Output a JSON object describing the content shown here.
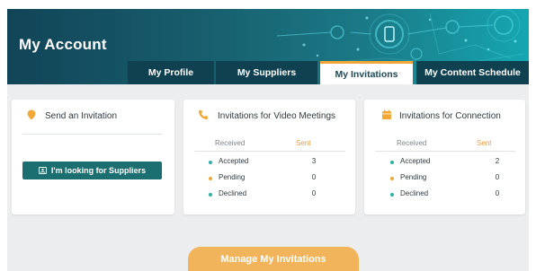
{
  "banner": {
    "title": "My Account"
  },
  "tabs": [
    {
      "label": "My Profile",
      "active": false
    },
    {
      "label": "My Suppliers",
      "active": false
    },
    {
      "label": "My Invitations",
      "active": true
    },
    {
      "label": "My Content Schedule",
      "active": false
    }
  ],
  "send_card": {
    "title": "Send an Invitation",
    "button_label": "I'm looking for Suppliers"
  },
  "video_card": {
    "title": "Invitations for Video Meetings",
    "col_received": "Received",
    "col_sent": "Sent",
    "rows": [
      {
        "label": "Accepted",
        "value": "3",
        "dot": "#2bb3a7"
      },
      {
        "label": "Pending",
        "value": "0",
        "dot": "#f2a736"
      },
      {
        "label": "Declined",
        "value": "0",
        "dot": "#2bb3a7"
      }
    ]
  },
  "connection_card": {
    "title": "Invitations for Connection",
    "col_received": "Received",
    "col_sent": "Sent",
    "rows": [
      {
        "label": "Accepted",
        "value": "2",
        "dot": "#2bb3a7"
      },
      {
        "label": "Pending",
        "value": "0",
        "dot": "#f2a736"
      },
      {
        "label": "Declined",
        "value": "0",
        "dot": "#2bb3a7"
      }
    ]
  },
  "manage_button": {
    "label": "Manage My Invitations"
  },
  "colors": {
    "accent": "#f2a736",
    "banner_dark": "#114457",
    "button_teal": "#1c6f70",
    "content_bg": "#ecedef"
  }
}
